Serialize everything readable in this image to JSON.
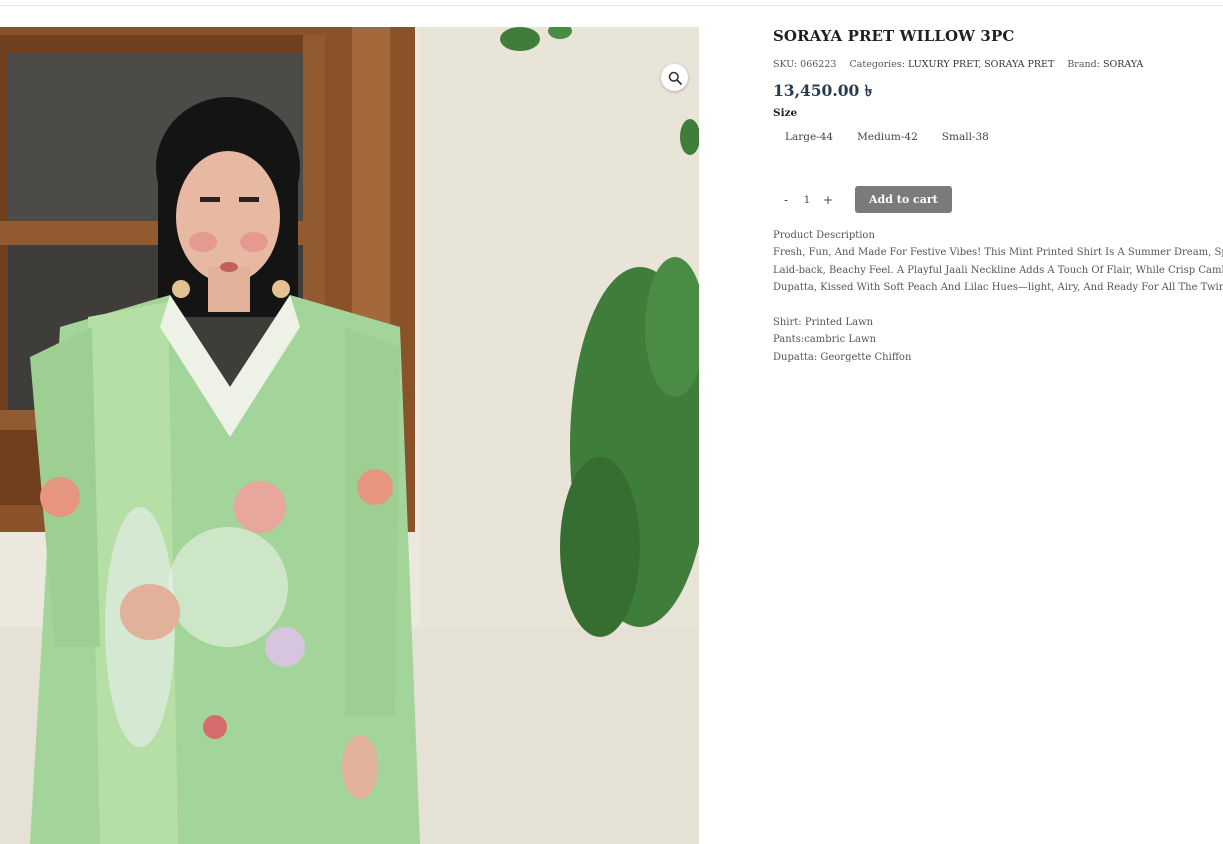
{
  "product": {
    "title": "SORAYA PRET WILLOW 3PC",
    "sku_label": "SKU:",
    "sku": "066223",
    "categories_label": "Categories:",
    "categories": [
      "LUXURY PRET",
      "SORAYA PRET"
    ],
    "brand_label": "Brand:",
    "brand": "SORAYA",
    "price": "13,450.00 ৳",
    "size_label": "Size",
    "sizes": [
      "Large-44",
      "Medium-42",
      "Small-38"
    ],
    "quantity": "1",
    "qty_minus": "-",
    "qty_plus": "+",
    "add_to_cart": "Add to cart",
    "description_heading": "Product Description",
    "description_lines": [
      "Fresh, Fun, And Made For Festive Vibes! This Mint Printed Shirt Is A Summer Dream, Splashed",
      "Laid-back, Beachy Feel. A Playful Jaali Neckline Adds A Touch Of Flair, While Crisp Cambric I",
      "Dupatta, Kissed With Soft Peach And Lilac Hues—light, Airy, And Ready For All The Twirls An"
    ],
    "specs": [
      "Shirt: Printed Lawn",
      "Pants:cambric Lawn",
      "Dupatta: Georgette Chiffon"
    ]
  },
  "gallery": {
    "zoom_icon": "magnifier-icon"
  },
  "colors": {
    "wall": "#ebe6db",
    "window_frame": "#8a5229",
    "dress": "#a3d49a",
    "leaves": "#3f7d3a",
    "button": "#7b7b7b",
    "price": "#2a3b4d"
  }
}
